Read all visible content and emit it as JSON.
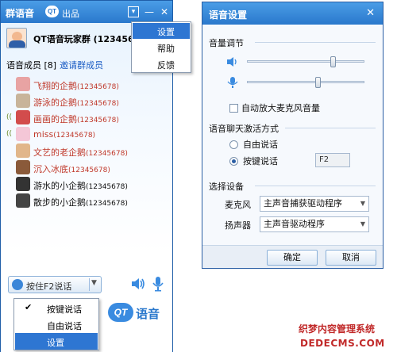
{
  "left_window": {
    "title": "群语音",
    "tab_label": "出品",
    "tab_badge": "QT",
    "group_name": "QT语音玩家群 (12345678)",
    "members_header": "语音成员 [8]",
    "invite_link": "邀请群成员",
    "members": [
      {
        "name": "飞翔的企鹅",
        "id": "(12345678)",
        "color": "#c0392b",
        "speaking": false,
        "avatar_color": "#e8a3a3"
      },
      {
        "name": "游泳的企鹅",
        "id": "(12345678)",
        "color": "#c0392b",
        "speaking": false,
        "avatar_color": "#c8b49a"
      },
      {
        "name": "画画的企鹅",
        "id": "(12345678)",
        "color": "#c0392b",
        "speaking": true,
        "avatar_color": "#d24c4c"
      },
      {
        "name": "miss",
        "id": "(12345678)",
        "color": "#c0392b",
        "speaking": true,
        "avatar_color": "#f4c7d7"
      },
      {
        "name": "文艺的老企鹅",
        "id": "(12345678)",
        "color": "#c0392b",
        "speaking": false,
        "avatar_color": "#e1b68a"
      },
      {
        "name": "沉入冰底",
        "id": "(12345678)",
        "color": "#c0392b",
        "speaking": false,
        "avatar_color": "#8a5a3a"
      },
      {
        "name": "游水的小企鹅",
        "id": "(12345678)",
        "color": "#111111",
        "speaking": false,
        "avatar_color": "#333333"
      },
      {
        "name": "散步的小企鹅",
        "id": "(12345678)",
        "color": "#111111",
        "speaking": false,
        "avatar_color": "#444444"
      }
    ],
    "talk_button": "按住F2说话",
    "logo_text": "语音",
    "logo_badge": "QT"
  },
  "top_menu": {
    "items": [
      "设置",
      "帮助",
      "反馈"
    ],
    "active_index": 0
  },
  "bottom_menu": {
    "items": [
      {
        "label": "按键说话",
        "checked": true
      },
      {
        "label": "自由说话",
        "checked": false
      },
      {
        "label": "设置",
        "checked": false
      }
    ],
    "active_index": 2
  },
  "dialog": {
    "title": "语音设置",
    "volume_section": "音量调节",
    "speaker_volume": 0.73,
    "mic_volume": 0.6,
    "auto_boost_label": "自动放大麦克风音量",
    "auto_boost_checked": false,
    "mode_section": "语音聊天激活方式",
    "mode_free": "自由说话",
    "mode_key": "按键说话",
    "selected_mode": "key",
    "hotkey": "F2",
    "device_section": "选择设备",
    "mic_label": "麦克风",
    "mic_device": "主声音捕获驱动程序",
    "speaker_label": "扬声器",
    "speaker_device": "主声音驱动程序",
    "ok_button": "确定",
    "cancel_button": "取消"
  },
  "watermark": {
    "line1": "织梦内容管理系统",
    "line2": "DEDECMS.COM"
  }
}
